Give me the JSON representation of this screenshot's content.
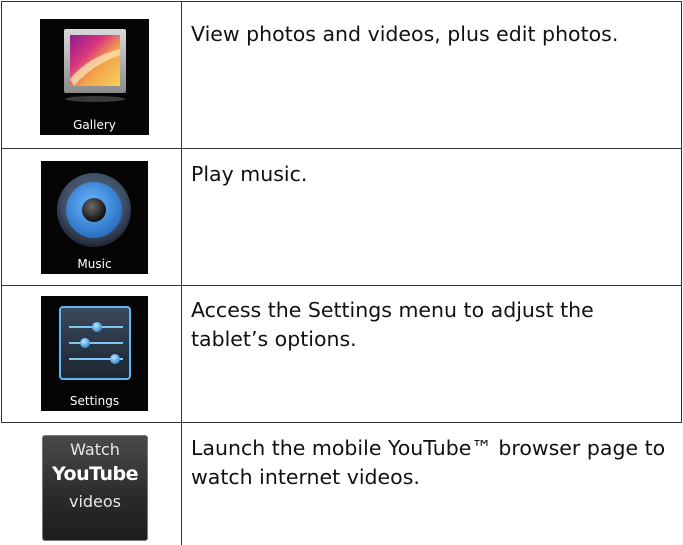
{
  "rows": [
    {
      "icon": "gallery-icon",
      "caption": "Gallery",
      "description": "View photos and videos, plus edit photos."
    },
    {
      "icon": "music-icon",
      "caption": "Music",
      "description": "Play music."
    },
    {
      "icon": "settings-icon",
      "caption": "Settings",
      "description": "Access the Settings menu to adjust the tablet’s options."
    },
    {
      "icon": "youtube-icon",
      "caption_lines": [
        "Watch",
        "YouTube",
        "videos"
      ],
      "description": "Launch the mobile YouTube™ browser page to watch internet videos."
    }
  ],
  "colors": {
    "border": "#333333",
    "tile_background": "#050505",
    "text": "#111111",
    "accent_blue": "#4aa8e8"
  }
}
